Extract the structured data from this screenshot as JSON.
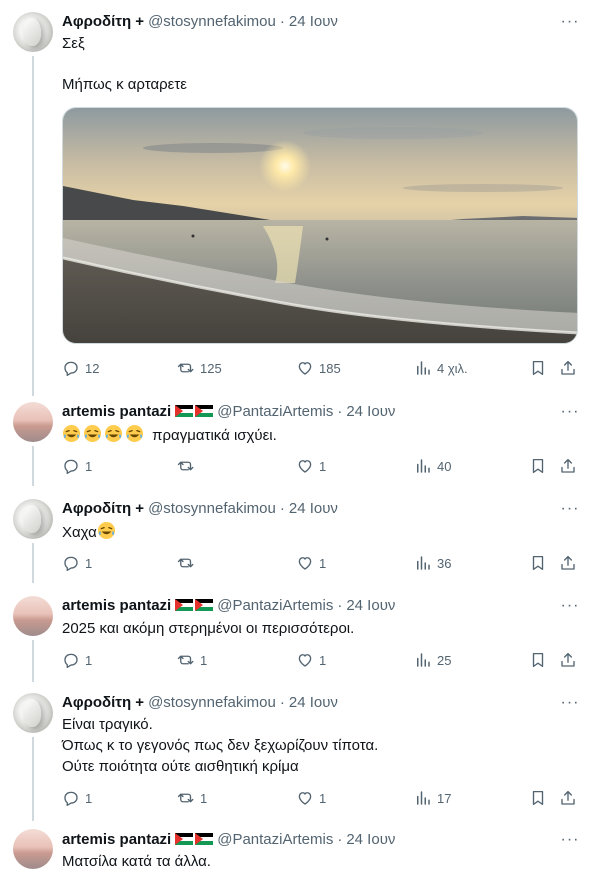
{
  "tweets": [
    {
      "name": "Αφροδίτη +",
      "handle": "@stosynnefakimou",
      "date": "24 Ιουν",
      "lines": [
        "Σεξ",
        "",
        "Μήπως κ αρταρετε"
      ],
      "stats": {
        "replies": "12",
        "retweets": "125",
        "likes": "185",
        "views": "4 χιλ."
      }
    },
    {
      "name": "artemis pantazi",
      "handle": "@PantaziArtemis",
      "date": "24 Ιουν",
      "text": "πραγματικά ισχύει.",
      "stats": {
        "replies": "1",
        "retweets": "",
        "likes": "1",
        "views": "40"
      }
    },
    {
      "name": "Αφροδίτη +",
      "handle": "@stosynnefakimou",
      "date": "24 Ιουν",
      "text": "Χαχα",
      "stats": {
        "replies": "1",
        "retweets": "",
        "likes": "1",
        "views": "36"
      }
    },
    {
      "name": "artemis pantazi",
      "handle": "@PantaziArtemis",
      "date": "24 Ιουν",
      "text": "2025 και ακόμη στερημένοι οι περισσότεροι.",
      "stats": {
        "replies": "1",
        "retweets": "1",
        "likes": "1",
        "views": "25"
      }
    },
    {
      "name": "Αφροδίτη +",
      "handle": "@stosynnefakimou",
      "date": "24 Ιουν",
      "lines": [
        "Είναι τραγικό.",
        "Όπως κ το γεγονός πως δεν ξεχωρίζουν τίποτα.",
        "Ούτε ποιότητα ούτε αισθητική κρίμα"
      ],
      "stats": {
        "replies": "1",
        "retweets": "1",
        "likes": "1",
        "views": "17"
      }
    },
    {
      "name": "artemis pantazi",
      "handle": "@PantaziArtemis",
      "date": "24 Ιουν",
      "text": "Ματσίλα κατά τα άλλα."
    }
  ],
  "separator": "·",
  "more_glyph": "···",
  "colors": {
    "text": "#0f1419",
    "secondary": "#536471",
    "thread": "#cfd9de"
  }
}
